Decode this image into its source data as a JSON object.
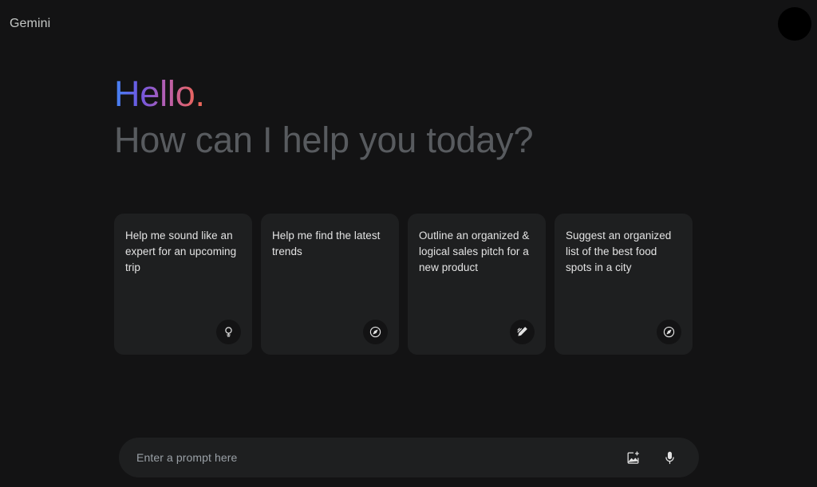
{
  "app": {
    "brand": "Gemini",
    "background_color": "#131314",
    "surface_color": "#1e1f20",
    "text_color": "#e3e3e3"
  },
  "topbar": {
    "brand_label": "Gemini",
    "avatar_name": "account-avatar",
    "avatar_color": "#000000"
  },
  "greeting": {
    "hello": "Hello.",
    "subtitle": "How can I help you today?",
    "gradient_start": "#4285f4",
    "gradient_mid": "#b85fb0",
    "gradient_end": "#ef6a5b",
    "subtitle_color": "#585b5f"
  },
  "suggestions": [
    {
      "text": "Help me sound like an expert for an upcoming trip",
      "icon": "lightbulb-icon"
    },
    {
      "text": "Help me find the latest trends",
      "icon": "compass-icon"
    },
    {
      "text": "Outline an organized & logical sales pitch for a new product",
      "icon": "edit-pencil-icon"
    },
    {
      "text": "Suggest an organized list of the best food spots in a city",
      "icon": "compass-icon"
    }
  ],
  "prompt": {
    "placeholder": "Enter a prompt here",
    "value": "",
    "add_image_icon": "add-image-icon",
    "microphone_icon": "microphone-icon"
  }
}
